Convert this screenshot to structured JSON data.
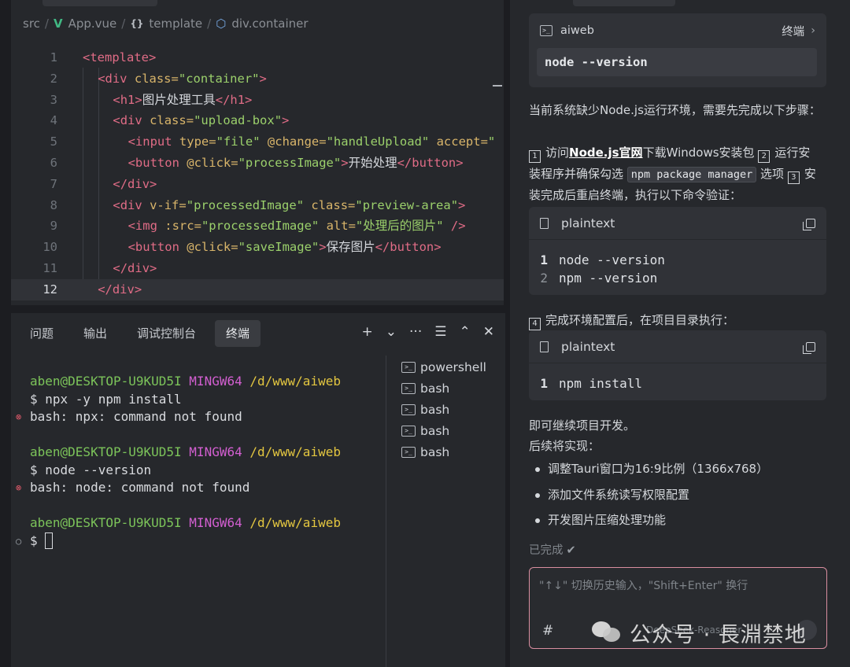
{
  "editor": {
    "breadcrumb": {
      "src": "src",
      "file": "App.vue",
      "template": "template",
      "element": "div.container"
    },
    "lines": [
      {
        "n": "1",
        "active": false,
        "indent": 0,
        "parts": [
          {
            "t": "tag",
            "v": "<template>"
          }
        ]
      },
      {
        "n": "2",
        "active": false,
        "indent": 1,
        "parts": [
          {
            "t": "tag",
            "v": "<div "
          },
          {
            "t": "attr",
            "v": "class="
          },
          {
            "t": "str",
            "v": "\"container\""
          },
          {
            "t": "tag",
            "v": ">"
          }
        ]
      },
      {
        "n": "3",
        "active": false,
        "indent": 2,
        "parts": [
          {
            "t": "tag",
            "v": "<h1>"
          },
          {
            "t": "txt",
            "v": "图片处理工具"
          },
          {
            "t": "tag",
            "v": "</h1>"
          }
        ]
      },
      {
        "n": "4",
        "active": false,
        "indent": 2,
        "parts": [
          {
            "t": "tag",
            "v": "<div "
          },
          {
            "t": "attr",
            "v": "class="
          },
          {
            "t": "str",
            "v": "\"upload-box\""
          },
          {
            "t": "tag",
            "v": ">"
          }
        ]
      },
      {
        "n": "5",
        "active": false,
        "indent": 3,
        "parts": [
          {
            "t": "tag",
            "v": "<input "
          },
          {
            "t": "attr",
            "v": "type="
          },
          {
            "t": "str",
            "v": "\"file\""
          },
          {
            "t": "attr",
            "v": " @change="
          },
          {
            "t": "str",
            "v": "\"handleUpload\""
          },
          {
            "t": "attr",
            "v": " accept="
          },
          {
            "t": "str",
            "v": "\""
          }
        ]
      },
      {
        "n": "6",
        "active": false,
        "indent": 3,
        "parts": [
          {
            "t": "tag",
            "v": "<button "
          },
          {
            "t": "attr",
            "v": "@click="
          },
          {
            "t": "str",
            "v": "\"processImage\""
          },
          {
            "t": "tag",
            "v": ">"
          },
          {
            "t": "txt",
            "v": "开始处理"
          },
          {
            "t": "tag",
            "v": "</button>"
          }
        ]
      },
      {
        "n": "7",
        "active": false,
        "indent": 2,
        "parts": [
          {
            "t": "tag",
            "v": "</div>"
          }
        ]
      },
      {
        "n": "8",
        "active": false,
        "indent": 2,
        "parts": [
          {
            "t": "tag",
            "v": "<div "
          },
          {
            "t": "attr",
            "v": "v-if="
          },
          {
            "t": "str",
            "v": "\"processedImage\""
          },
          {
            "t": "attr",
            "v": " class="
          },
          {
            "t": "str",
            "v": "\"preview-area\""
          },
          {
            "t": "tag",
            "v": ">"
          }
        ]
      },
      {
        "n": "9",
        "active": false,
        "indent": 3,
        "parts": [
          {
            "t": "tag",
            "v": "<img "
          },
          {
            "t": "attr",
            "v": ":src="
          },
          {
            "t": "str",
            "v": "\"processedImage\""
          },
          {
            "t": "attr",
            "v": " alt="
          },
          {
            "t": "str",
            "v": "\"处理后的图片\""
          },
          {
            "t": "tag",
            "v": " />"
          }
        ]
      },
      {
        "n": "10",
        "active": false,
        "indent": 3,
        "parts": [
          {
            "t": "tag",
            "v": "<button "
          },
          {
            "t": "attr",
            "v": "@click="
          },
          {
            "t": "str",
            "v": "\"saveImage\""
          },
          {
            "t": "tag",
            "v": ">"
          },
          {
            "t": "txt",
            "v": "保存图片"
          },
          {
            "t": "tag",
            "v": "</button>"
          }
        ]
      },
      {
        "n": "11",
        "active": false,
        "indent": 2,
        "parts": [
          {
            "t": "tag",
            "v": "</div>"
          }
        ]
      },
      {
        "n": "12",
        "active": true,
        "indent": 1,
        "parts": [
          {
            "t": "tag",
            "v": "</div>"
          }
        ]
      }
    ]
  },
  "panel": {
    "tabs": [
      {
        "label": "问题",
        "active": false
      },
      {
        "label": "输出",
        "active": false
      },
      {
        "label": "调试控制台",
        "active": false
      },
      {
        "label": "终端",
        "active": true
      }
    ],
    "actions": [
      "+",
      "⌄",
      "···",
      "☰",
      "⌃",
      "✕"
    ],
    "terminal": [
      {
        "type": "prompt",
        "user": "aben@DESKTOP-U9KUD5I",
        "host": "MINGW64",
        "path": "/d/www/aiweb"
      },
      {
        "type": "cmd",
        "text": "$ npx -y npm install"
      },
      {
        "type": "err",
        "text": "bash: npx: command not found"
      },
      {
        "type": "blank"
      },
      {
        "type": "prompt",
        "user": "aben@DESKTOP-U9KUD5I",
        "host": "MINGW64",
        "path": "/d/www/aiweb"
      },
      {
        "type": "cmd",
        "text": "$ node --version"
      },
      {
        "type": "err",
        "text": "bash: node: command not found"
      },
      {
        "type": "blank"
      },
      {
        "type": "prompt",
        "user": "aben@DESKTOP-U9KUD5I",
        "host": "MINGW64",
        "path": "/d/www/aiweb"
      },
      {
        "type": "input",
        "text": "$ "
      }
    ],
    "shells": [
      "powershell",
      "bash",
      "bash",
      "bash",
      "bash"
    ]
  },
  "chat": {
    "terminal_card": {
      "name": "aiweb",
      "label": "终端",
      "command": "node --version"
    },
    "para1": "当前系统缺少Node.js运行环境，需要先完成以下步骤：",
    "steps": {
      "s1_num": "1",
      "s1_a": "访问",
      "s1_link": "Node.js官网",
      "s1_b": "下载Windows安装包",
      "s2_num": "2",
      "s2_a": "运行安装程序并确保勾选",
      "s2_code": "npm package manager",
      "s2_b": "选项",
      "s3_num": "3",
      "s3_a": "安装完成后重启终端，执行以下命令验证："
    },
    "code1": {
      "lang": "plaintext",
      "lines": [
        {
          "n": "1",
          "text": "node --version"
        },
        {
          "n": "2",
          "text": "npm --version"
        }
      ]
    },
    "step4_num": "4",
    "step4_text": "完成环境配置后，在项目目录执行：",
    "code2": {
      "lang": "plaintext",
      "lines": [
        {
          "n": "1",
          "text": "npm install"
        }
      ]
    },
    "after1": "即可继续项目开发。",
    "after2": "后续将实现：",
    "bullets": [
      "调整Tauri窗口为16:9比例（1366x768）",
      "添加文件系统读写权限配置",
      "开发图片压缩处理功能"
    ],
    "done": "已完成",
    "input_placeholder": "\"↑↓\" 切换历史输入，\"Shift+Enter\" 换行",
    "hash": "#",
    "model": "DeepSeek-Reasoner"
  },
  "watermark": "公众号 · 長淵禁地",
  "colors": {
    "tag": "#e06c86",
    "attr": "#d9b56a",
    "string": "#9bd06b",
    "prompt_user": "#7cc45a",
    "prompt_host": "#d35fd1",
    "prompt_path": "#e3c640",
    "error_mark": "#e05a6a",
    "input_border": "#d98ea0"
  }
}
